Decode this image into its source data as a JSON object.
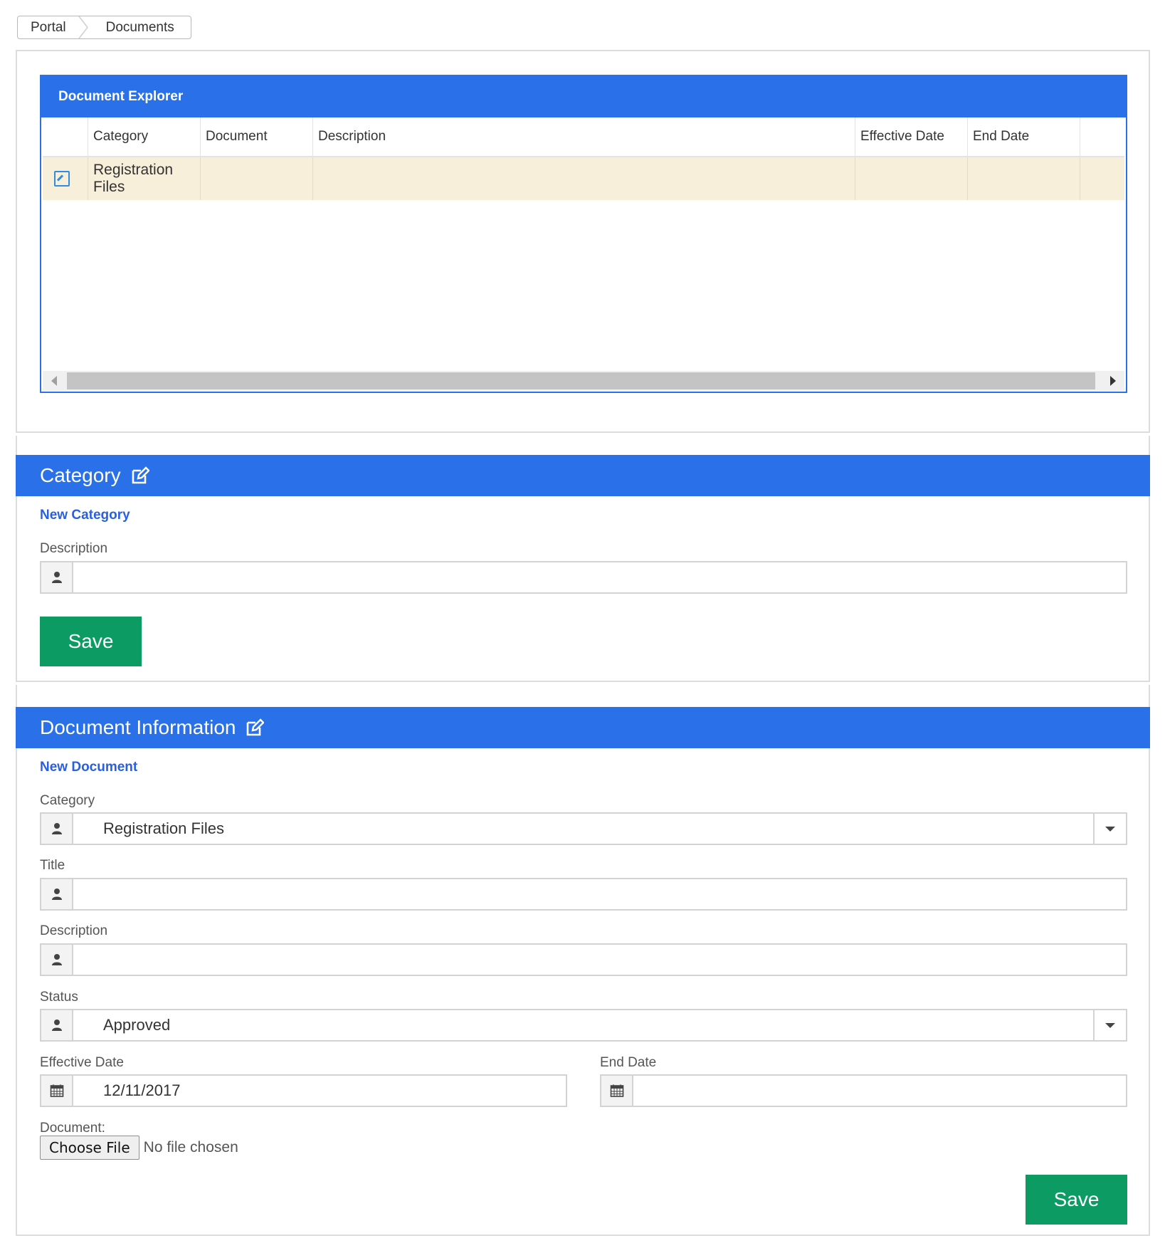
{
  "breadcrumb": {
    "items": [
      "Portal",
      "Documents"
    ]
  },
  "explorer": {
    "title": "Document Explorer",
    "columns": [
      "Category",
      "Document",
      "Description",
      "Effective Date",
      "End Date"
    ],
    "rows": [
      {
        "category": "Registration Files",
        "document": "",
        "description": "",
        "effective_date": "",
        "end_date": ""
      }
    ]
  },
  "category_section": {
    "title": "Category",
    "new_link": "New Category",
    "description_label": "Description",
    "description_value": "",
    "save_label": "Save"
  },
  "document_section": {
    "title": "Document Information",
    "new_link": "New Document",
    "category_label": "Category",
    "category_value": "Registration Files",
    "title_label": "Title",
    "title_value": "",
    "description_label": "Description",
    "description_value": "",
    "status_label": "Status",
    "status_value": "Approved",
    "effective_date_label": "Effective Date",
    "effective_date_value": "12/11/2017",
    "end_date_label": "End Date",
    "end_date_value": "",
    "document_label": "Document:",
    "choose_file_label": "Choose File",
    "no_file_text": "No file chosen",
    "save_label": "Save"
  },
  "colors": {
    "accent": "#2a70e8",
    "save": "#0c9c63",
    "link": "#2a5fe0",
    "row_highlight": "#f7efd9"
  }
}
